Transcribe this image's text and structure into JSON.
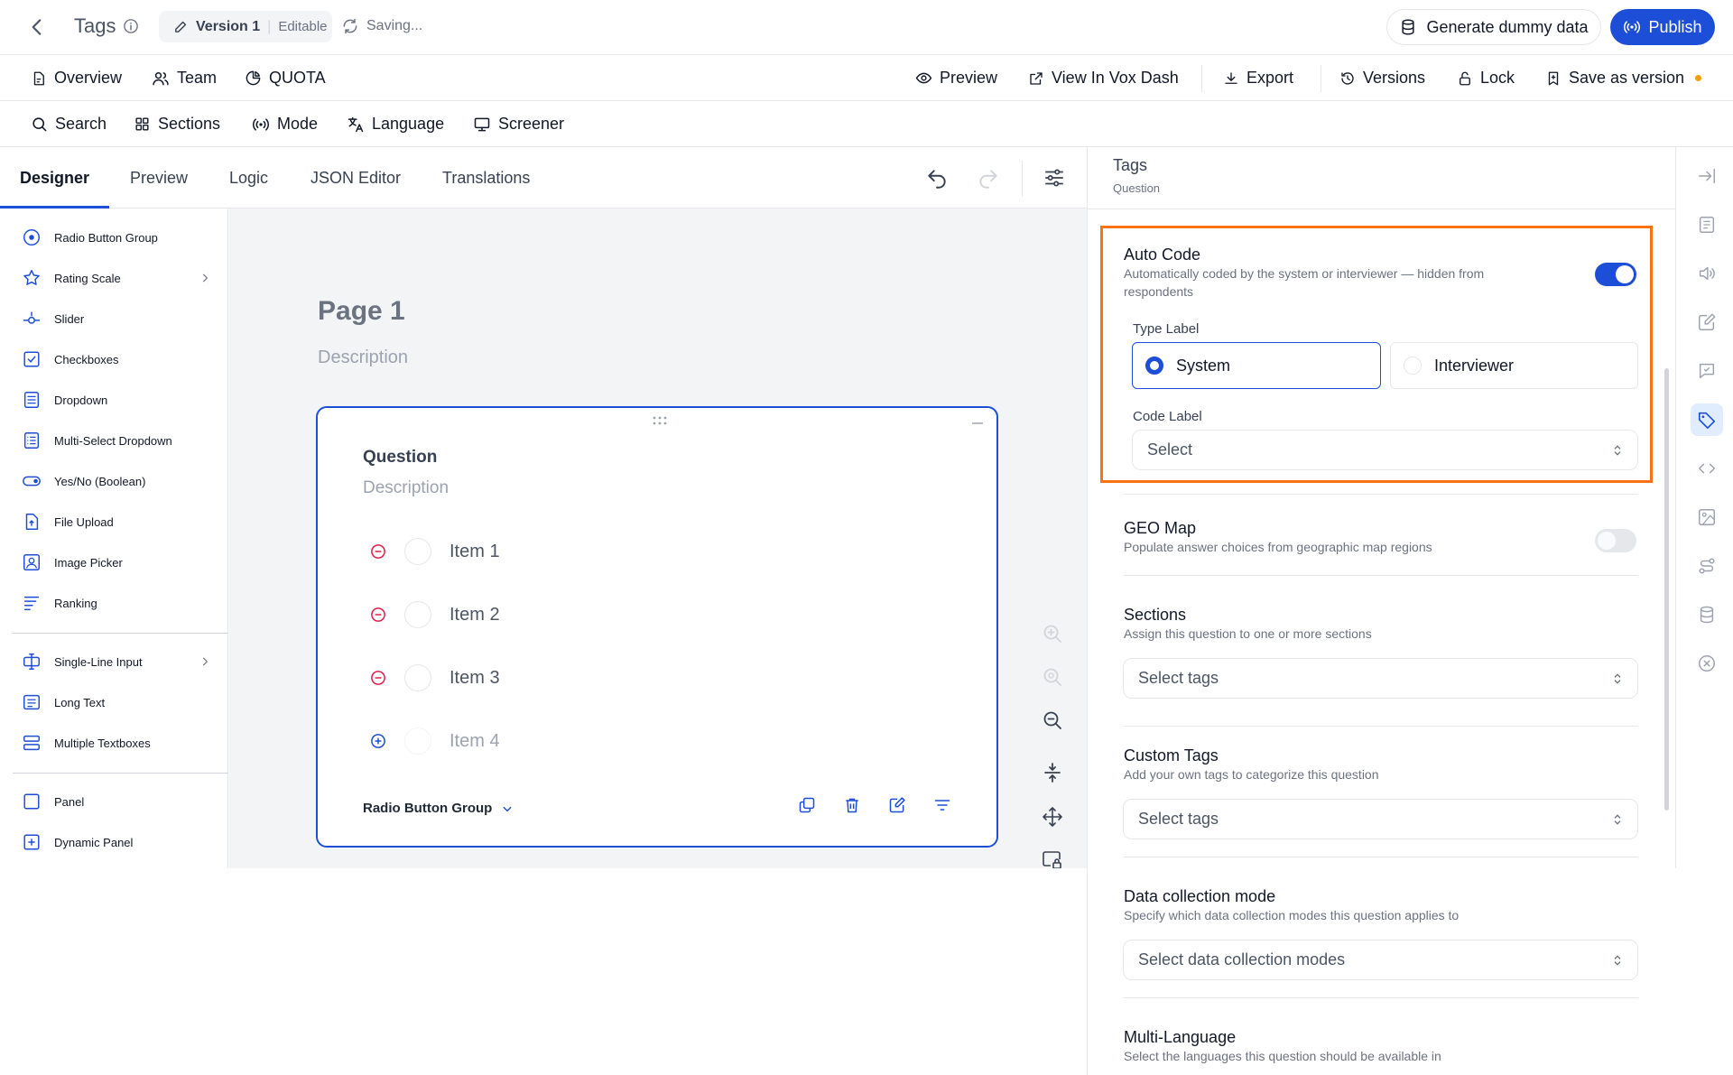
{
  "topbar": {
    "title": "Tags",
    "version_label": "Version 1",
    "version_sep": "|",
    "version_status": "Editable",
    "saving_text": "Saving...",
    "dummy_data_label": "Generate dummy data",
    "publish_label": "Publish"
  },
  "navbar": {
    "left": [
      "Overview",
      "Team",
      "QUOTA"
    ],
    "right": [
      "Preview",
      "View In Vox Dash",
      "Export",
      "Versions",
      "Lock",
      "Save as version"
    ]
  },
  "toolbar": {
    "items": [
      "Search",
      "Sections",
      "Mode",
      "Language",
      "Screener"
    ]
  },
  "tabs": [
    "Designer",
    "Preview",
    "Logic",
    "JSON Editor",
    "Translations"
  ],
  "sidebar": {
    "group1": [
      "Radio Button Group",
      "Rating Scale",
      "Slider",
      "Checkboxes",
      "Dropdown",
      "Multi-Select Dropdown",
      "Yes/No (Boolean)",
      "File Upload",
      "Image Picker",
      "Ranking"
    ],
    "group2": [
      "Single-Line Input",
      "Long Text",
      "Multiple Textboxes"
    ],
    "group3": [
      "Panel",
      "Dynamic Panel"
    ]
  },
  "canvas": {
    "page_title": "Page 1",
    "page_description": "Description",
    "question": {
      "title": "Question",
      "description": "Description",
      "items": [
        "Item 1",
        "Item 2",
        "Item 3",
        "Item 4"
      ],
      "type_label": "Radio Button Group"
    }
  },
  "panel": {
    "title": "Tags",
    "subtitle": "Question",
    "auto_code": {
      "title": "Auto Code",
      "description": "Automatically coded by the system or interviewer — hidden from respondents",
      "enabled": true,
      "type_label": "Type Label",
      "options": [
        "System",
        "Interviewer"
      ],
      "selected": "System",
      "code_label": "Code Label",
      "code_placeholder": "Select"
    },
    "geo_map": {
      "title": "GEO Map",
      "description": "Populate answer choices from geographic map regions",
      "enabled": false
    },
    "sections": {
      "title": "Sections",
      "description": "Assign this question to one or more sections",
      "placeholder": "Select tags"
    },
    "custom_tags": {
      "title": "Custom Tags",
      "description": "Add your own tags to categorize this question",
      "placeholder": "Select tags"
    },
    "data_collection": {
      "title": "Data collection mode",
      "description": "Specify which data collection modes this question applies to",
      "placeholder": "Select data collection modes"
    },
    "multi_language": {
      "title": "Multi-Language",
      "description": "Select the languages this question should be available in"
    }
  },
  "colors": {
    "accent": "#1d4ed8",
    "highlight": "#f97316",
    "remove": "#e11d48",
    "status_dot": "#f59e0b"
  }
}
